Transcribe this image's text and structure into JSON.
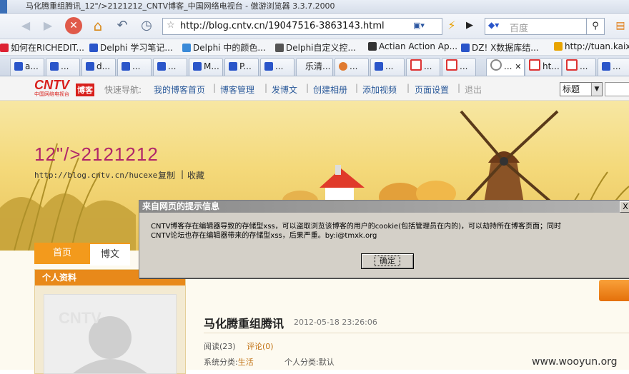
{
  "window": {
    "title": "马化腾重组腾讯_12\"/>2121212_CNTV博客_中国网络电视台 - 傲游浏览器 3.3.7.2000"
  },
  "toolbar": {
    "url": "http://blog.cntv.cn/19047516-3863143.html",
    "search_placeholder": "百度"
  },
  "bookmarks": [
    {
      "label": "如何在RICHEDIT...",
      "color": "#d23"
    },
    {
      "label": "Delphi 学习笔记...",
      "color": "#2a55c9"
    },
    {
      "label": "Delphi 中的颜色...",
      "color": "#3a8ad8"
    },
    {
      "label": "Delphi自定义控...",
      "color": "#555"
    },
    {
      "label": "Actian Action Ap...",
      "color": "#333"
    },
    {
      "label": "DZ! X数据库结...",
      "color": "#2a55c9"
    },
    {
      "label": "http://tuan.kaixin",
      "color": "#e8a400"
    }
  ],
  "tabs": [
    {
      "label": "a..."
    },
    {
      "label": "..."
    },
    {
      "label": "d..."
    },
    {
      "label": "..."
    },
    {
      "label": "..."
    },
    {
      "label": "M..."
    },
    {
      "label": "P..."
    },
    {
      "label": "..."
    },
    {
      "label": "乐清..."
    },
    {
      "label": "..."
    },
    {
      "label": "..."
    },
    {
      "label": "..."
    },
    {
      "label": "..."
    },
    {
      "label": "..."
    },
    {
      "label": "ht..."
    },
    {
      "label": "..."
    },
    {
      "label": "..."
    }
  ],
  "cntv_nav": {
    "logo_text": "CNTV",
    "logo_sub": "中国网络电视台",
    "logo_badge": "博客",
    "quick_nav_label": "快速导航:",
    "links": [
      "我的博客首页",
      "博客管理",
      "发博文",
      "创建相册",
      "添加视频",
      "页面设置",
      "退出"
    ],
    "search_select": "标题"
  },
  "banner": {
    "blog_title": "12\"/>2121212",
    "blog_url": "http://blog.cntv.cn/hucexe",
    "copy": "复制",
    "favorite": "收藏"
  },
  "content": {
    "tab_home": "首页",
    "tab_post": "博文",
    "sidebar_title": "个人资料",
    "post_title": "马化腾重组腾讯",
    "post_date": "2012-05-18 23:26:06",
    "reads": "阅读(23)",
    "comments": "评论(0)",
    "category_label": "系统分类:",
    "category_value": "生活",
    "personal_category": "个人分类:默认",
    "watermark": "www.wooyun.org"
  },
  "dialog": {
    "title": "来自网页的提示信息",
    "message_line1": "CNTV博客存在编辑器导致的存储型xss，可以盗取浏览该博客的用户的cookie(包括管理员在内的)，可以劫持所在博客页面；同时",
    "message_line2": "CNTV论坛也存在编辑器带来的存储型xss，后果严重。by:i@tmxk.org",
    "ok_label": "确定",
    "close_label": "X"
  }
}
